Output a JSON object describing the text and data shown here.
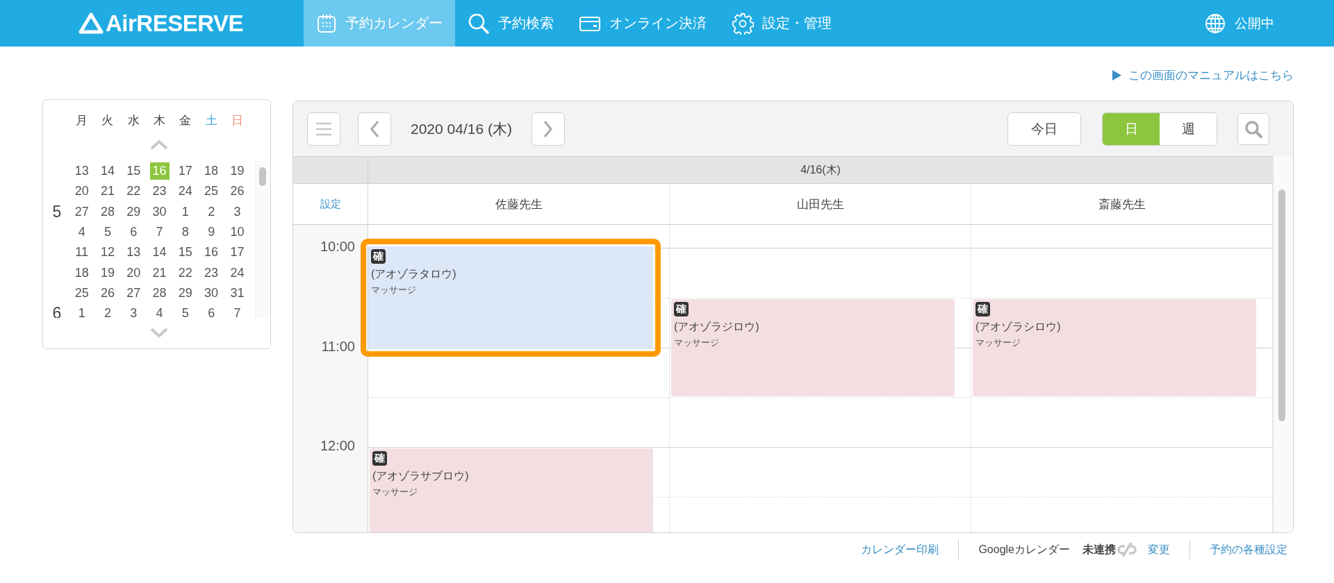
{
  "header": {
    "logo": "AirRESERVE",
    "nav": [
      {
        "label": "予約カレンダー",
        "selected": true
      },
      {
        "label": "予約検索",
        "selected": false
      },
      {
        "label": "オンライン決済",
        "selected": false
      },
      {
        "label": "設定・管理",
        "selected": false
      }
    ],
    "status": "公開中"
  },
  "manual_link": "この画面のマニュアルはこちら",
  "mini_calendar": {
    "weekdays": [
      {
        "label": "月",
        "kind": "weekday"
      },
      {
        "label": "火",
        "kind": "weekday"
      },
      {
        "label": "水",
        "kind": "weekday"
      },
      {
        "label": "木",
        "kind": "weekday"
      },
      {
        "label": "金",
        "kind": "weekday"
      },
      {
        "label": "土",
        "kind": "saturday"
      },
      {
        "label": "日",
        "kind": "sunday"
      }
    ],
    "weeks": [
      {
        "days": [
          {
            "label": "13",
            "selected": false
          },
          {
            "label": "14",
            "selected": false
          },
          {
            "label": "15",
            "selected": false
          },
          {
            "label": "16",
            "selected": true
          },
          {
            "label": "17",
            "selected": false
          },
          {
            "label": "18",
            "selected": false
          },
          {
            "label": "19",
            "selected": false
          }
        ]
      },
      {
        "days": [
          {
            "label": "20",
            "selected": false
          },
          {
            "label": "21",
            "selected": false
          },
          {
            "label": "22",
            "selected": false
          },
          {
            "label": "23",
            "selected": false
          },
          {
            "label": "24",
            "selected": false
          },
          {
            "label": "25",
            "selected": false
          },
          {
            "label": "26",
            "selected": false
          }
        ]
      },
      {
        "month": "5",
        "days": [
          {
            "label": "27",
            "selected": false
          },
          {
            "label": "28",
            "selected": false
          },
          {
            "label": "29",
            "selected": false
          },
          {
            "label": "30",
            "selected": false
          },
          {
            "label": "1",
            "selected": false
          },
          {
            "label": "2",
            "selected": false
          },
          {
            "label": "3",
            "selected": false
          }
        ]
      },
      {
        "days": [
          {
            "label": "4",
            "selected": false
          },
          {
            "label": "5",
            "selected": false
          },
          {
            "label": "6",
            "selected": false
          },
          {
            "label": "7",
            "selected": false
          },
          {
            "label": "8",
            "selected": false
          },
          {
            "label": "9",
            "selected": false
          },
          {
            "label": "10",
            "selected": false
          }
        ]
      },
      {
        "days": [
          {
            "label": "11",
            "selected": false
          },
          {
            "label": "12",
            "selected": false
          },
          {
            "label": "13",
            "selected": false
          },
          {
            "label": "14",
            "selected": false
          },
          {
            "label": "15",
            "selected": false
          },
          {
            "label": "16",
            "selected": false
          },
          {
            "label": "17",
            "selected": false
          }
        ]
      },
      {
        "days": [
          {
            "label": "18",
            "selected": false
          },
          {
            "label": "19",
            "selected": false
          },
          {
            "label": "20",
            "selected": false
          },
          {
            "label": "21",
            "selected": false
          },
          {
            "label": "22",
            "selected": false
          },
          {
            "label": "23",
            "selected": false
          },
          {
            "label": "24",
            "selected": false
          }
        ]
      },
      {
        "days": [
          {
            "label": "25",
            "selected": false
          },
          {
            "label": "26",
            "selected": false
          },
          {
            "label": "27",
            "selected": false
          },
          {
            "label": "28",
            "selected": false
          },
          {
            "label": "29",
            "selected": false
          },
          {
            "label": "30",
            "selected": false
          },
          {
            "label": "31",
            "selected": false
          }
        ]
      },
      {
        "month": "6",
        "days": [
          {
            "label": "1",
            "selected": false
          },
          {
            "label": "2",
            "selected": false
          },
          {
            "label": "3",
            "selected": false
          },
          {
            "label": "4",
            "selected": false
          },
          {
            "label": "5",
            "selected": false
          },
          {
            "label": "6",
            "selected": false
          },
          {
            "label": "7",
            "selected": false
          }
        ]
      }
    ]
  },
  "toolbar": {
    "date": "2020 04/16 (木)",
    "today_button": "今日",
    "view_toggle": [
      {
        "label": "日",
        "selected": true
      },
      {
        "label": "週",
        "selected": false
      }
    ]
  },
  "schedule": {
    "date_header": "4/16(木)",
    "settings_link": "設定",
    "time_labels": [
      "10:00",
      "11:00",
      "12:00"
    ],
    "staff": [
      {
        "name": "佐藤先生",
        "reservations": [
          {
            "status": "確",
            "customer": "(アオゾラタロウ)",
            "menu": "マッサージ",
            "selected": true
          },
          {
            "status": "確",
            "customer": "(アオゾラサブロウ)",
            "menu": "マッサージ",
            "selected": false
          }
        ]
      },
      {
        "name": "山田先生",
        "reservations": [
          {
            "status": "確",
            "customer": "(アオゾラジロウ)",
            "menu": "マッサージ",
            "selected": false
          }
        ]
      },
      {
        "name": "斎藤先生",
        "reservations": [
          {
            "status": "確",
            "customer": "(アオゾラシロウ)",
            "menu": "マッサージ",
            "selected": false
          }
        ]
      }
    ]
  },
  "footer": {
    "print_link": "カレンダー印刷",
    "google_label": "Googleカレンダー",
    "google_status": "未連携",
    "change_link": "変更",
    "settings_link": "予約の各種設定"
  }
}
